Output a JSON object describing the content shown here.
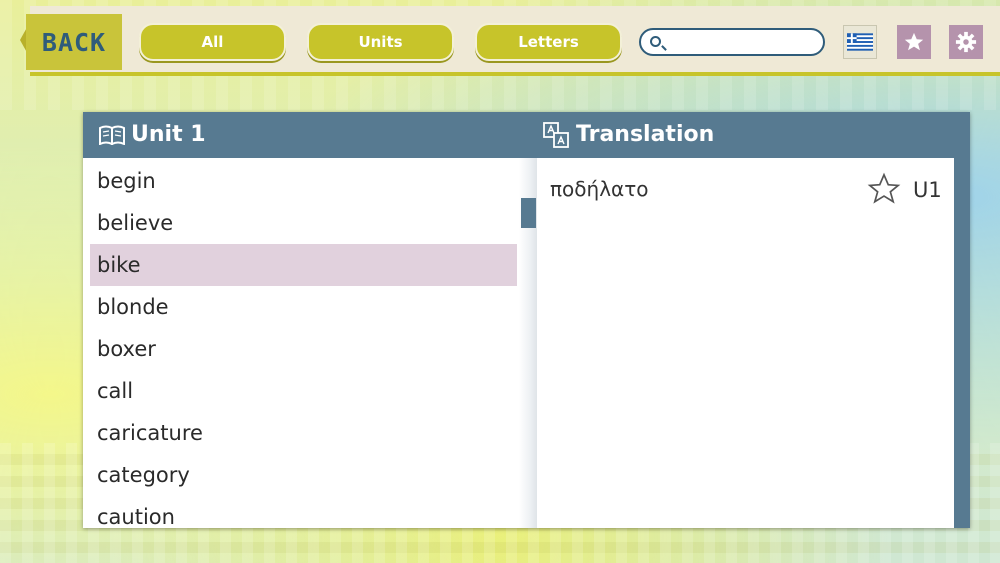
{
  "nav": {
    "back_label": "BACK",
    "filters": [
      "All",
      "Units",
      "Letters"
    ],
    "search_placeholder": "",
    "language_flag": "greek-flag",
    "favorites_icon": "star-icon",
    "settings_icon": "gear-icon"
  },
  "panel": {
    "left_header": "Unit 1",
    "right_header": "Translation",
    "words": [
      "begin",
      "believe",
      "bike",
      "blonde",
      "boxer",
      "call",
      "caricature",
      "category",
      "caution"
    ],
    "selected_word": "bike",
    "translation": {
      "text": "ποδήλατο",
      "unit": "U1",
      "favorited": false
    }
  },
  "colors": {
    "accent": "#c7c42a",
    "header": "#577a91",
    "selection": "#e1d1dd",
    "button_purple": "#b593ac",
    "back_text": "#2f5c7a"
  }
}
